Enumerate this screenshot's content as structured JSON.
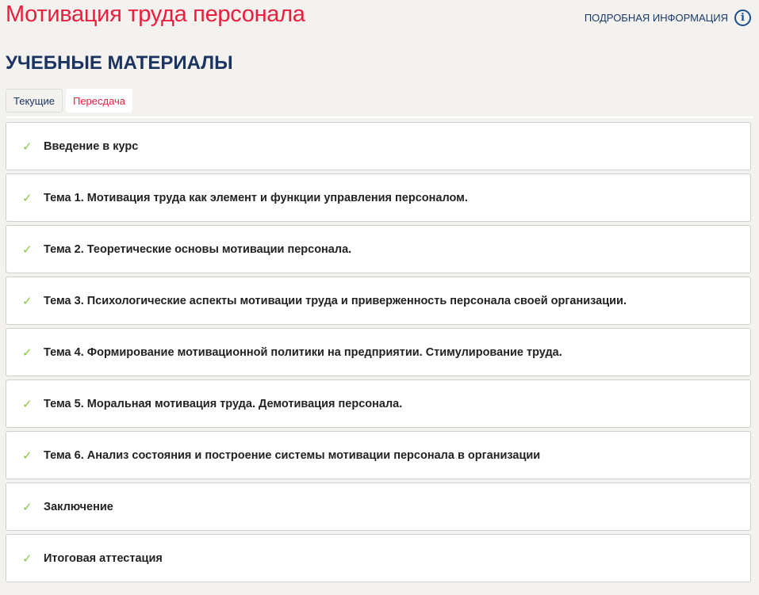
{
  "header": {
    "title": "Мотивация труда персонала",
    "info_link": "ПОДРОБНАЯ ИНФОРМАЦИЯ"
  },
  "section_title": "УЧЕБНЫЕ МАТЕРИАЛЫ",
  "tabs": [
    {
      "label": "Текущие"
    },
    {
      "label": "Пересдача"
    }
  ],
  "colors": {
    "accent": "#e8203f",
    "navy": "#1b3461",
    "check": "#8cc63f"
  },
  "items": [
    {
      "label": "Введение в курс"
    },
    {
      "label": "Тема 1. Мотивация труда как элемент и функции управления персоналом."
    },
    {
      "label": "Тема 2. Теоретические основы мотивации персонала."
    },
    {
      "label": "Тема 3. Психологические аспекты мотивации труда и приверженность персонала своей организации."
    },
    {
      "label": "Тема 4. Формирование мотивационной политики на предприятии. Стимулирование труда."
    },
    {
      "label": "Тема 5. Моральная мотивация труда. Демотивация персонала."
    },
    {
      "label": "Тема 6. Анализ состояния и построение системы мотивации персонала в организации"
    },
    {
      "label": "Заключение"
    },
    {
      "label": "Итоговая аттестация"
    }
  ]
}
